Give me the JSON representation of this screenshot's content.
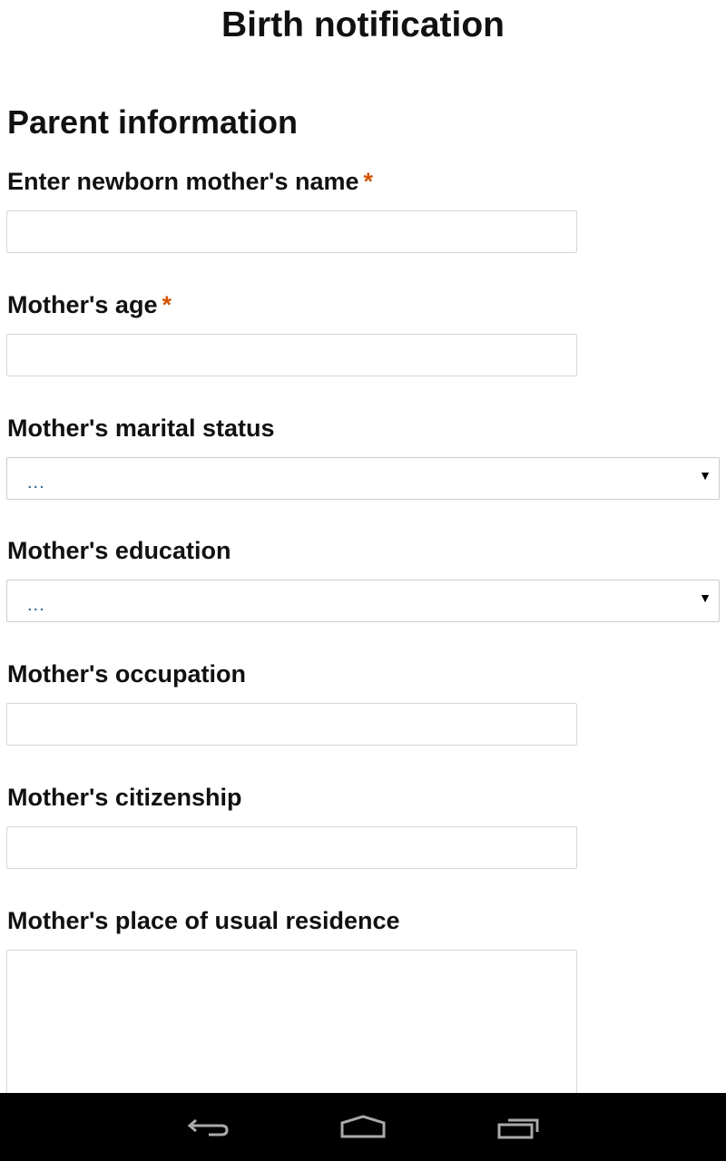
{
  "header": {
    "title": "Birth notification"
  },
  "section": {
    "title": "Parent information"
  },
  "fields": [
    {
      "label": "Enter newborn mother's name",
      "required": "*",
      "type": "text",
      "value": ""
    },
    {
      "label": "Mother's age",
      "required": "*",
      "type": "text",
      "value": ""
    },
    {
      "label": "Mother's marital status",
      "type": "select",
      "value": "..."
    },
    {
      "label": "Mother's education",
      "type": "select",
      "value": "..."
    },
    {
      "label": "Mother's occupation",
      "type": "text",
      "value": ""
    },
    {
      "label": "Mother's citizenship",
      "type": "text",
      "value": ""
    },
    {
      "label": "Mother's place of usual residence",
      "type": "textarea",
      "value": ""
    }
  ],
  "navbar": {
    "icons": [
      "back-icon",
      "home-icon",
      "recent-apps-icon"
    ]
  },
  "colors": {
    "required": "#d35400",
    "select_value": "#2a5d8a"
  }
}
